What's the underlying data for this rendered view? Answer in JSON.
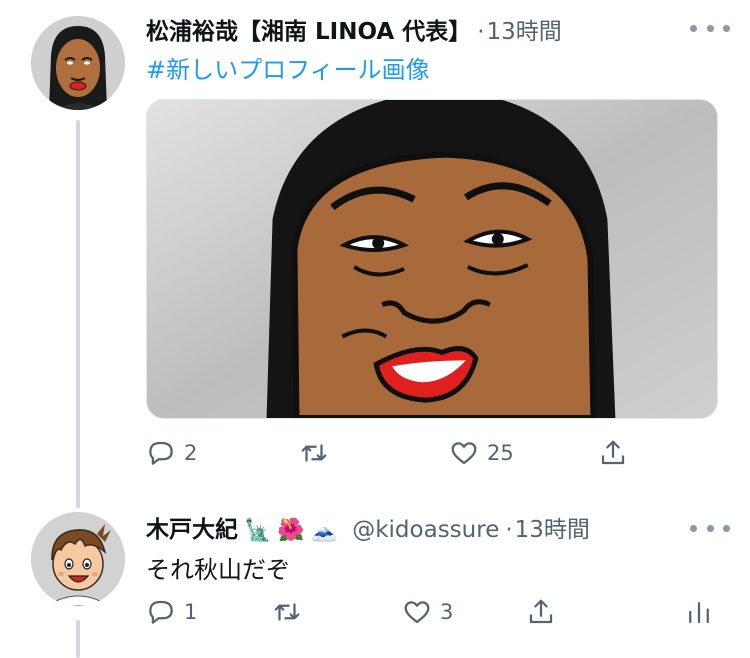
{
  "tweet1": {
    "author_name": "松浦裕哉【湘南 LINOA 代表】",
    "dot": "·",
    "time": "13時間",
    "text": "#新しいプロフィール画像",
    "replies": "2",
    "likes": "25",
    "icons": [
      "more-icon",
      "reply-icon",
      "retweet-icon",
      "like-icon",
      "share-icon"
    ]
  },
  "tweet2": {
    "author_name": "木戸大紀",
    "name_emojis": [
      "🗽",
      "🌺",
      "🗻"
    ],
    "handle": "@kidoassure",
    "dot": "·",
    "time": "13時間",
    "text": "それ秋山だぞ",
    "replies": "1",
    "likes": "3",
    "icons": [
      "more-icon",
      "reply-icon",
      "retweet-icon",
      "like-icon",
      "share-icon",
      "analytics-icon"
    ]
  },
  "colors": {
    "hashtag": "#1d9bf0",
    "secondary_text": "#536471",
    "thread_line": "#cfd9de",
    "skin": "#a8693b",
    "lips": "#e0201e"
  }
}
